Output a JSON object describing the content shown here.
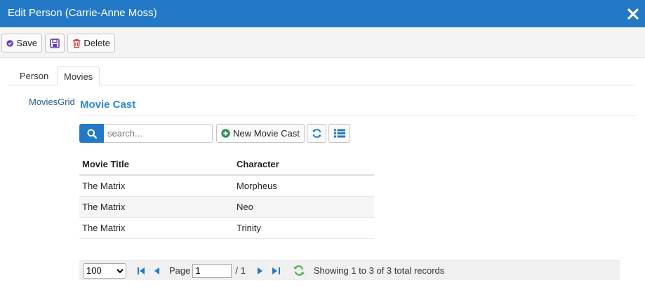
{
  "dialog": {
    "title": "Edit Person (Carrie-Anne Moss)",
    "close_icon": "close-icon"
  },
  "toolbar": {
    "save_label": "Save",
    "save_icon": "check-circle-icon",
    "apply_icon": "floppy-disk-icon",
    "delete_label": "Delete",
    "delete_icon": "trash-icon"
  },
  "tabs": [
    {
      "label": "Person",
      "active": false
    },
    {
      "label": "Movies",
      "active": true
    }
  ],
  "movies": {
    "field_label": "MoviesGrid",
    "section_title": "Movie Cast",
    "search_placeholder": "search...",
    "search_icon": "search-icon",
    "new_button_label": "New Movie Cast",
    "new_button_icon": "plus-circle-icon",
    "refresh_icon": "refresh-icon",
    "columns_icon": "list-icon",
    "columns": [
      "Movie Title",
      "Character"
    ],
    "rows": [
      [
        "The Matrix",
        "Morpheus"
      ],
      [
        "The Matrix",
        "Neo"
      ],
      [
        "The Matrix",
        "Trinity"
      ]
    ]
  },
  "pager": {
    "page_size": "100",
    "page_size_options": [
      "100"
    ],
    "page_label": "Page",
    "current_page": "1",
    "total_pages_text": "/ 1",
    "status": "Showing 1 to 3 of 3 total records"
  },
  "colors": {
    "titlebar": "#2379c5",
    "accent": "#2a87d0",
    "save_icon": "#6a3fb5",
    "delete_icon": "#c9302c",
    "new_icon": "#2e8b57",
    "refresh_icon": "#2379c5"
  }
}
